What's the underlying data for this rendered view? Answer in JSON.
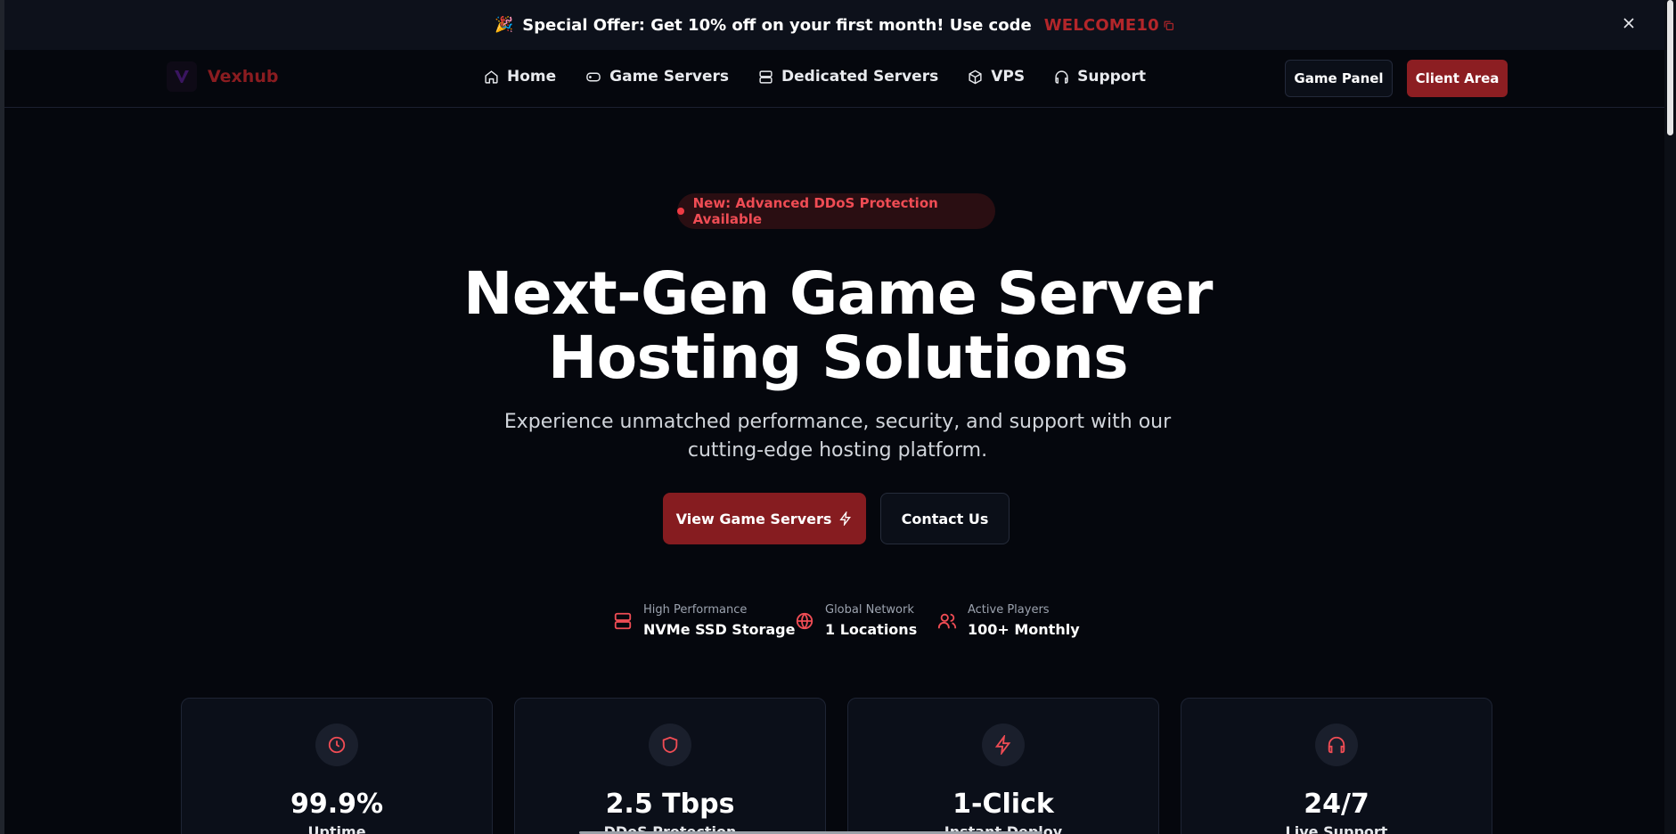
{
  "banner": {
    "party_emoji": "🎉",
    "text": "Special Offer: Get 10% off on your first month! Use code",
    "code": "WELCOME10"
  },
  "nav": {
    "logo_text": "Vexhub",
    "links": [
      {
        "label": "Home",
        "icon": "home-icon"
      },
      {
        "label": "Game Servers",
        "icon": "gamepad-icon"
      },
      {
        "label": "Dedicated Servers",
        "icon": "server-icon"
      },
      {
        "label": "VPS",
        "icon": "box-icon"
      },
      {
        "label": "Support",
        "icon": "headphones-icon"
      }
    ],
    "game_panel": "Game Panel",
    "client_area": "Client Area"
  },
  "hero": {
    "badge": "New: Advanced DDoS Protection Available",
    "title_line1": "Next-Gen Game Server",
    "title_line2": "Hosting Solutions",
    "subtitle_line1": "Experience unmatched performance, security, and support with our",
    "subtitle_line2": "cutting-edge hosting platform.",
    "primary_button": "View Game Servers",
    "secondary_button": "Contact Us"
  },
  "stats": [
    {
      "label": "High Performance",
      "value": "NVMe SSD Storage",
      "icon": "server-icon"
    },
    {
      "label": "Global Network",
      "value": "1 Locations",
      "icon": "globe-icon"
    },
    {
      "label": "Active Players",
      "value": "100+ Monthly",
      "icon": "users-icon"
    }
  ],
  "features": [
    {
      "value": "99.9%",
      "label": "Uptime",
      "icon": "clock-icon"
    },
    {
      "value": "2.5 Tbps",
      "label": "DDoS Protection",
      "icon": "shield-icon"
    },
    {
      "value": "1-Click",
      "label": "Instant Deploy",
      "icon": "lightning-icon"
    },
    {
      "value": "24/7",
      "label": "Live Support",
      "icon": "headphones-icon"
    }
  ],
  "colors": {
    "background": "#05070d",
    "accent": "#8c1e22",
    "accent_text": "#ef4c54"
  }
}
